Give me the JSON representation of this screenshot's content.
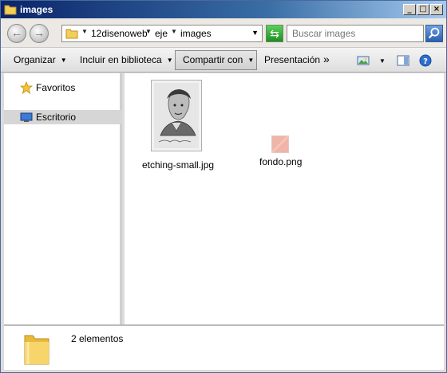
{
  "window": {
    "title": "images",
    "minimize": "_",
    "maximize": "□",
    "close": "×"
  },
  "address": {
    "crumbs": [
      "12disenoweb",
      "eje",
      "images"
    ],
    "search_placeholder": "Buscar images"
  },
  "toolbar": {
    "organize": "Organizar",
    "include": "Incluir en biblioteca",
    "share": "Compartir con",
    "presentation": "Presentación",
    "more": "»"
  },
  "nav": {
    "favorites": "Favoritos",
    "desktop": "Escritorio"
  },
  "files": [
    {
      "name": "etching-small.jpg",
      "type": "jpg"
    },
    {
      "name": "fondo.png",
      "type": "png"
    }
  ],
  "details": {
    "count_text": "2 elementos"
  },
  "colors": {
    "title_start": "#0a246a",
    "title_end": "#a6caf0",
    "selected_nav": "#d6d6d6",
    "png_thumb": "#f0b4a8"
  }
}
